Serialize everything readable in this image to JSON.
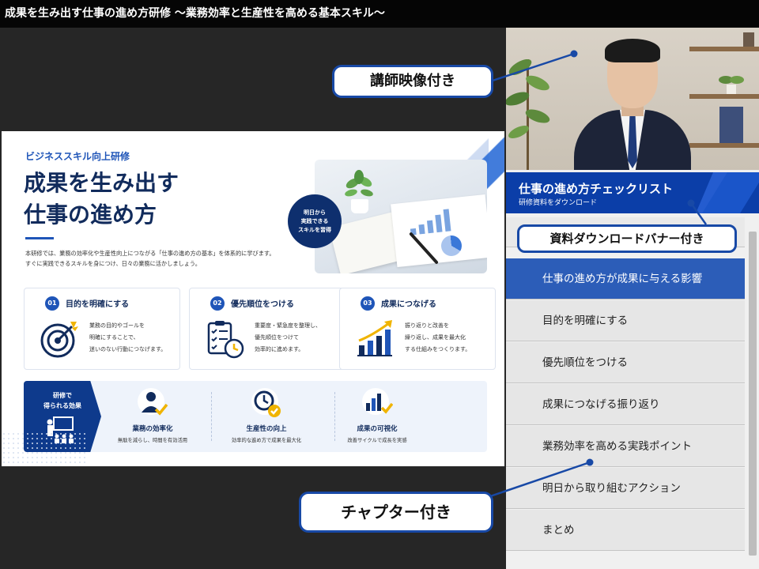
{
  "window": {
    "title": "成果を生み出す仕事の進め方研修 ～業務効率と生産性を高める基本スキル～"
  },
  "slide": {
    "kicker": "ビジネススキル向上研修",
    "title_line1": "成果を生み出す",
    "title_line2": "仕事の進め方",
    "lead_line1": "本研修では、業務の効率化や生産性向上につながる「仕事の進め方の基本」を体系的に学びます。",
    "lead_line2": "すぐに実践できるスキルを身につけ、日々の業務に活かしましょう。",
    "badge": "明日から\n実践できる\nスキルを習得",
    "cards": [
      {
        "num": "01",
        "title": "目的を明確にする",
        "desc": "業務の目的やゴールを\n明確にすることで、\n迷いのない行動につなげます。",
        "icon": "target-icon"
      },
      {
        "num": "02",
        "title": "優先順位をつける",
        "desc": "重要度・緊急度を整理し、\n優先順位をつけて\n効率的に進めます。",
        "icon": "checklist-clock-icon"
      },
      {
        "num": "03",
        "title": "成果につなげる",
        "desc": "振り返りと改善を\n繰り返し、成果を最大化\nする仕組みをつくります。",
        "icon": "growth-chart-icon"
      }
    ],
    "benefits_tag": "研修で\n得られる効果",
    "benefits": [
      {
        "title": "業務の効率化",
        "desc": "無駄を減らし、時間を有効活用",
        "icon": "person-check-icon"
      },
      {
        "title": "生産性の向上",
        "desc": "効率的な進め方で成果を最大化",
        "icon": "clock-check-icon"
      },
      {
        "title": "成果の可視化",
        "desc": "改善サイクルで成長を実感",
        "icon": "bar-check-icon"
      }
    ]
  },
  "sidebar": {
    "banner_title": "仕事の進め方チェックリスト",
    "banner_subtitle": "研修資料をダウンロード",
    "chapters": [
      "",
      "仕事の進め方が成果に与える影響",
      "目的を明確にする",
      "優先順位をつける",
      "成果につなげる振り返り",
      "業務効率を高める実践ポイント",
      "明日から取り組むアクション",
      "まとめ"
    ],
    "active_chapter": 1
  },
  "callouts": {
    "video": "講師映像付き",
    "download": "資料ダウンロードバナー付き",
    "chapters": "チャプター付き"
  },
  "colors": {
    "brand": "#0b3ea8",
    "active": "#2c5db8",
    "navy": "#112b5c",
    "callout_border": "#1849a6"
  }
}
